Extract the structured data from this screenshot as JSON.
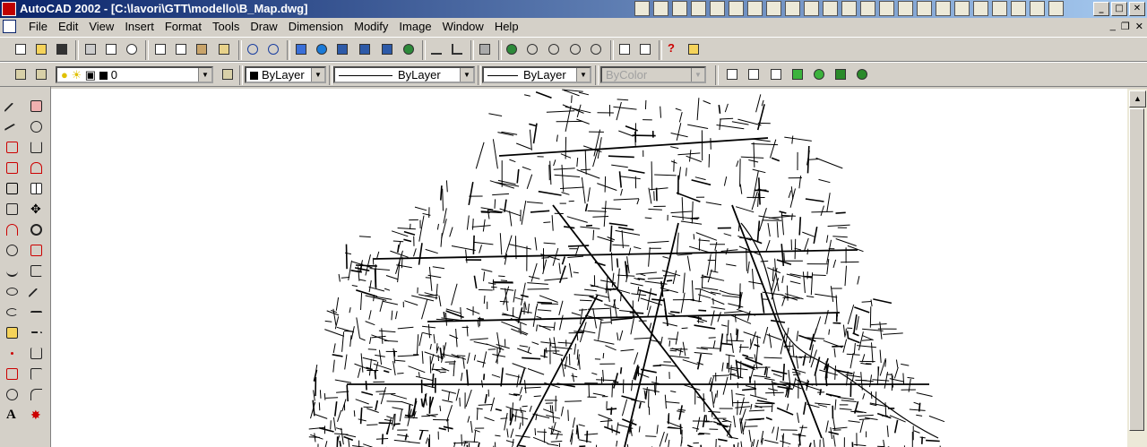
{
  "titlebar": {
    "title": "AutoCAD 2002 - [C:\\lavori\\GTT\\modello\\B_Map.dwg]"
  },
  "window_controls": {
    "minimize": "_",
    "maximize": "□",
    "close": "✕"
  },
  "menubar": {
    "items": [
      "File",
      "Edit",
      "View",
      "Insert",
      "Format",
      "Tools",
      "Draw",
      "Dimension",
      "Modify",
      "Image",
      "Window",
      "Help"
    ],
    "doc_controls": {
      "minimize": "_",
      "restore": "❐",
      "close": "✕"
    }
  },
  "standard_toolbar": {
    "buttons": [
      "new-icon",
      "open-icon",
      "save-icon",
      "print-icon",
      "print-preview-icon",
      "find-icon",
      "cut-icon",
      "copy-icon",
      "paste-icon",
      "match-properties-icon",
      "undo-icon",
      "redo-icon",
      "hyperlink-icon",
      "today-icon",
      "design-center-icon",
      "tool-palette-icon",
      "snapshot-icon",
      "distance-icon",
      "ucs-icon",
      "named-views-icon",
      "pan-icon",
      "zoom-realtime-icon",
      "zoom-window-icon",
      "zoom-previous-icon",
      "properties-icon",
      "adcenter-icon",
      "help-icon",
      "extensions-icon"
    ]
  },
  "layers_toolbar": {
    "layer_name": "0",
    "color": "ByLayer",
    "linetype": "ByLayer",
    "lineweight": "ByLayer",
    "plot_style": "ByColor"
  },
  "render_toolbar": {
    "buttons": [
      "render-icon",
      "scene-icon",
      "box-icon",
      "cube-icon",
      "sphere-icon",
      "cube-green-icon",
      "sphere-shaded-icon"
    ]
  },
  "draw_toolbar": {
    "tools": [
      "line",
      "construction-line",
      "polyline",
      "polygon",
      "rectangle",
      "arc",
      "circle",
      "spline",
      "ellipse",
      "ellipse-arc",
      "insert-block",
      "make-block",
      "point",
      "hatch",
      "region",
      "multiline-text"
    ]
  },
  "modify_toolbar": {
    "tools": [
      "erase",
      "copy",
      "mirror",
      "offset",
      "array",
      "move",
      "rotate",
      "scale",
      "stretch",
      "trim",
      "extend",
      "break",
      "chamfer",
      "fillet",
      "explode",
      "lengthen"
    ]
  },
  "colors": {
    "title_start": "#0a246a",
    "title_end": "#a6caf0",
    "chrome": "#d4d0c8",
    "canvas": "#ffffff"
  }
}
